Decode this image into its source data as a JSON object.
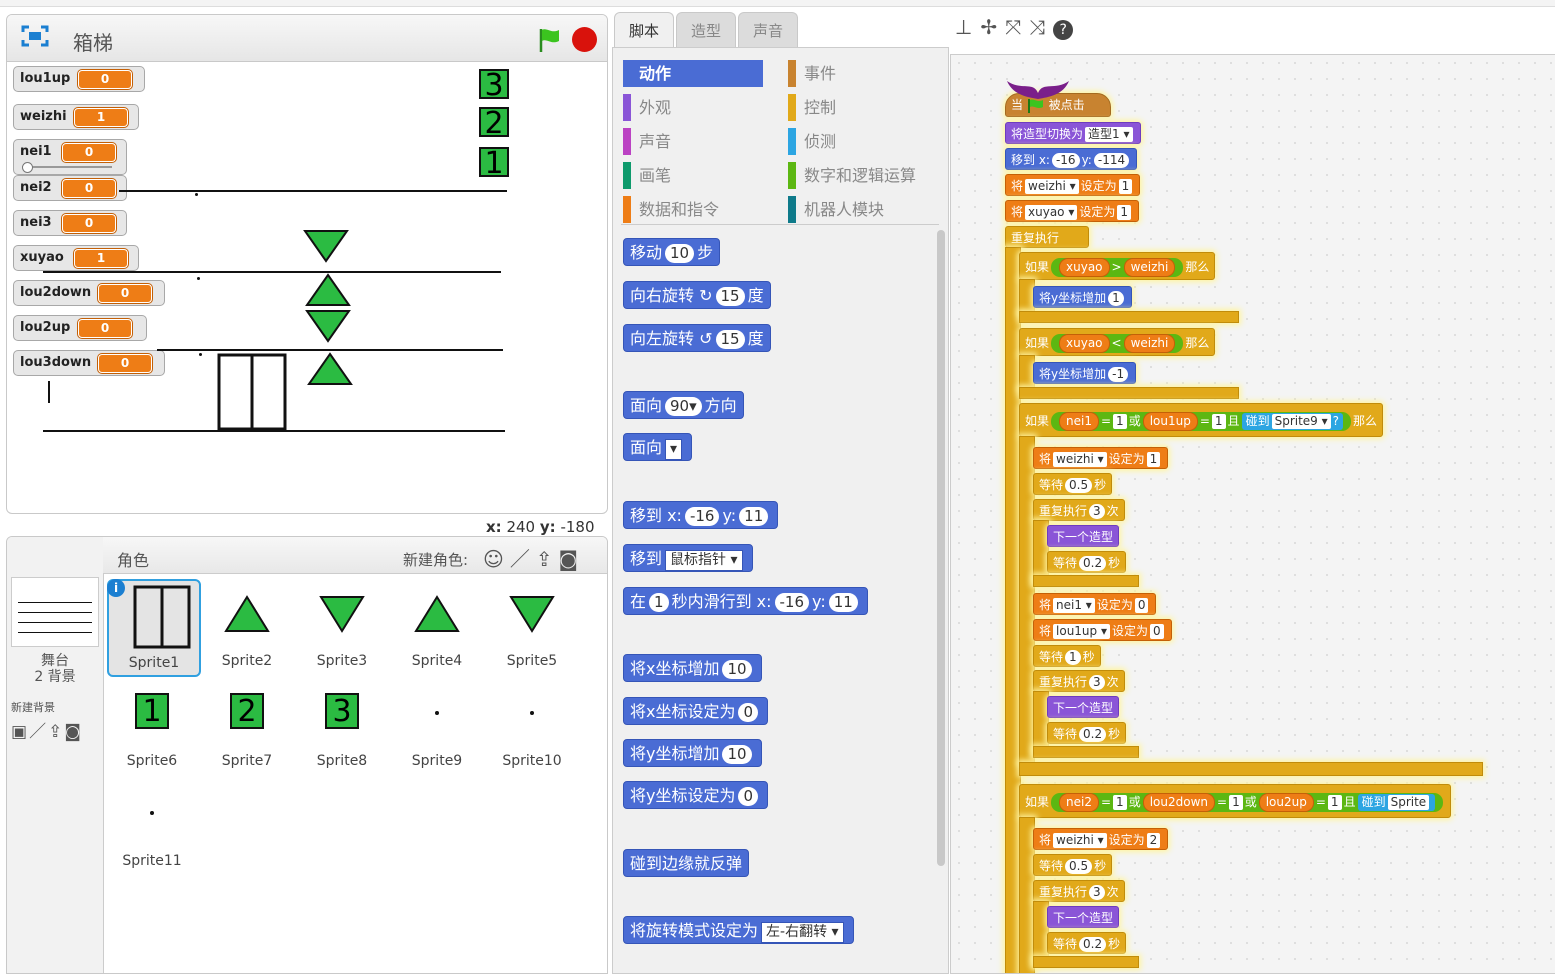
{
  "stage": {
    "title": "箱梯",
    "monitors": [
      {
        "name": "lou1up",
        "value": "0"
      },
      {
        "name": "weizhi",
        "value": "1"
      },
      {
        "name": "nei1",
        "value": "0"
      },
      {
        "name": "nei2",
        "value": "0"
      },
      {
        "name": "nei3",
        "value": "0"
      },
      {
        "name": "xuyao",
        "value": "1"
      },
      {
        "name": "lou2down",
        "value": "0"
      },
      {
        "name": "lou2up",
        "value": "0"
      },
      {
        "name": "lou3down",
        "value": "0"
      }
    ],
    "floor_numbers": [
      "3",
      "2",
      "1"
    ],
    "coords_x_label": "x:",
    "coords_x": "240",
    "coords_y_label": "y:",
    "coords_y": "-180"
  },
  "sprite_pane": {
    "header_label": "角色",
    "new_sprite_label": "新建角色:",
    "stage_label": "舞台",
    "backdrop_count": "2 背景",
    "new_backdrop_label": "新建背景",
    "sprites": [
      "Sprite1",
      "Sprite2",
      "Sprite3",
      "Sprite4",
      "Sprite5",
      "Sprite6",
      "Sprite7",
      "Sprite8",
      "Sprite9",
      "Sprite10",
      "Sprite11"
    ],
    "sprite_numbers": [
      "1",
      "2",
      "3"
    ]
  },
  "tabs": [
    "脚本",
    "造型",
    "声音"
  ],
  "categories": [
    {
      "label": "动作",
      "color": "#4a6cd4"
    },
    {
      "label": "事件",
      "color": "#c88330"
    },
    {
      "label": "外观",
      "color": "#8a55d7"
    },
    {
      "label": "控制",
      "color": "#e1a91a"
    },
    {
      "label": "声音",
      "color": "#bb42c3"
    },
    {
      "label": "侦测",
      "color": "#2ca5e2"
    },
    {
      "label": "画笔",
      "color": "#0e9a6c"
    },
    {
      "label": "数字和逻辑运算",
      "color": "#5cb712"
    },
    {
      "label": "数据和指令",
      "color": "#ee7d16"
    },
    {
      "label": "机器人模块",
      "color": "#0e7a8a"
    }
  ],
  "palette": {
    "move_a": "移动",
    "move_n": "10",
    "move_b": "步",
    "turn_r_a": "向右旋转",
    "turn_r_n": "15",
    "turn_r_b": "度",
    "turn_l_a": "向左旋转",
    "turn_l_n": "15",
    "turn_l_b": "度",
    "point_dir_a": "面向",
    "point_dir_n": "90▾",
    "point_dir_b": "方向",
    "point_to_a": "面向",
    "point_to_dd": "▾",
    "goto_xy_a": "移到 x:",
    "goto_xy_x": "-16",
    "goto_xy_b": "y:",
    "goto_xy_y": "11",
    "goto_a": "移到",
    "goto_dd": "鼠标指针 ▾",
    "glide_a": "在",
    "glide_n": "1",
    "glide_b": "秒内滑行到 x:",
    "glide_x": "-16",
    "glide_c": "y:",
    "glide_y": "11",
    "change_x_a": "将x坐标增加",
    "change_x_n": "10",
    "set_x_a": "将x坐标设定为",
    "set_x_n": "0",
    "change_y_a": "将y坐标增加",
    "change_y_n": "10",
    "set_y_a": "将y坐标设定为",
    "set_y_n": "0",
    "bounce": "碰到边缘就反弹",
    "rot_a": "将旋转模式设定为",
    "rot_dd": "左-右翻转 ▾"
  },
  "script": {
    "hat_a": "当",
    "hat_b": "被点击",
    "switch_costume": "将造型切换为",
    "costume1": "造型1 ▾",
    "goto_a": "移到 x:",
    "goto_x": "-16",
    "goto_b": "y:",
    "goto_y": "-114",
    "set": "将",
    "set_to": "设定为",
    "var_weizhi": "weizhi ▾",
    "var_xuyao": "xuyao ▾",
    "var_nei1": "nei1 ▾",
    "var_lou1up": "lou1up ▾",
    "one": "1",
    "two": "2",
    "zero": "0",
    "forever": "重复执行",
    "if": "如果",
    "then": "那么",
    "or": "或",
    "and": "且",
    "xuyao": "xuyao",
    "weizhi": "weizhi",
    "nei1": "nei1",
    "lou1up": "lou1up",
    "nei2": "nei2",
    "lou2down": "lou2down",
    "lou2up": "lou2up",
    "gt": ">",
    "lt": "<",
    "eq": "=",
    "change_y": "将y坐标增加",
    "plus1": "1",
    "minus1": "-1",
    "touching": "碰到",
    "sprite9": "Sprite9 ▾",
    "q": "?",
    "sprite_cut": "Sprite",
    "wait": "等待",
    "secs": "秒",
    "w05": "0.5",
    "w02": "0.2",
    "w1": "1",
    "repeat": "重复执行",
    "times": "次",
    "n3": "3",
    "next_costume": "下一个造型"
  },
  "toolbar_icons": [
    "stamp-icon",
    "cut-icon",
    "grow-icon",
    "shrink-icon",
    "help-icon"
  ]
}
